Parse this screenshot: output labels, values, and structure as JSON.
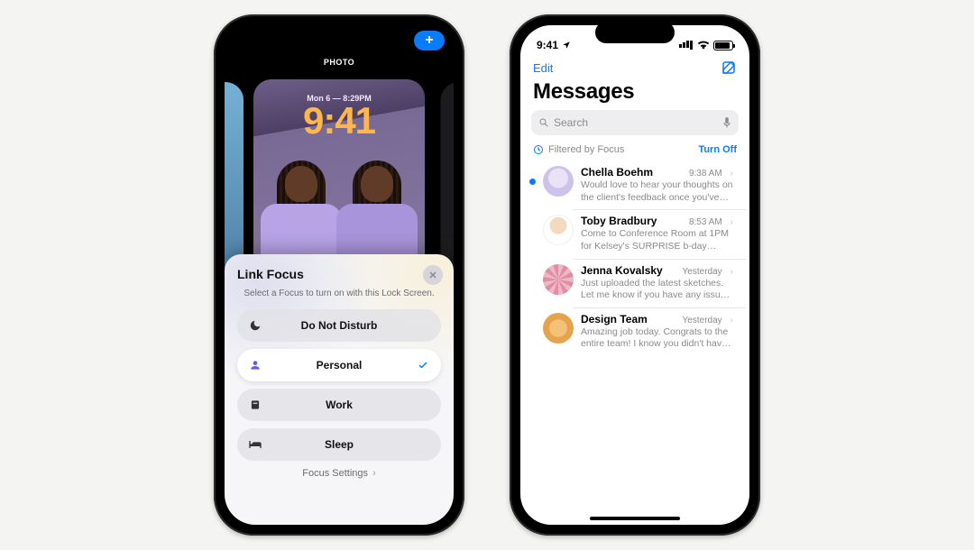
{
  "lockscreen": {
    "photo_label": "PHOTO",
    "date": "Mon 6 — 8:29PM",
    "time": "9:41"
  },
  "sheet": {
    "title": "Link Focus",
    "subtitle": "Select a Focus to turn on with this Lock Screen.",
    "items": {
      "dnd": "Do Not Disturb",
      "personal": "Personal",
      "work": "Work",
      "sleep": "Sleep"
    },
    "footer": "Focus Settings"
  },
  "messages": {
    "status_time": "9:41",
    "edit": "Edit",
    "title": "Messages",
    "search_placeholder": "Search",
    "filtered_label": "Filtered by Focus",
    "turn_off": "Turn Off",
    "threads": [
      {
        "name": "Chella Boehm",
        "time": "9:38 AM",
        "preview": "Would love to hear your thoughts on the client's feedback once you've finished th…",
        "unread": true
      },
      {
        "name": "Toby Bradbury",
        "time": "8:53 AM",
        "preview": "Come to Conference Room at 1PM for Kelsey's SURPRISE b-day celebration.",
        "unread": false
      },
      {
        "name": "Jenna Kovalsky",
        "time": "Yesterday",
        "preview": "Just uploaded the latest sketches. Let me know if you have any issues accessing.",
        "unread": false
      },
      {
        "name": "Design Team",
        "time": "Yesterday",
        "preview": "Amazing job today. Congrats to the entire team! I know you didn't have a lot of tim…",
        "unread": false
      }
    ]
  }
}
